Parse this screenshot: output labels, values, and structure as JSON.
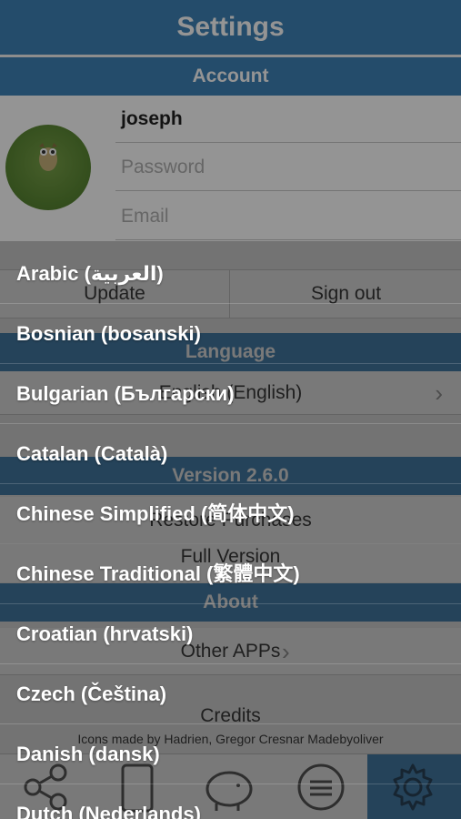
{
  "header": {
    "title": "Settings"
  },
  "account": {
    "section_label": "Account",
    "username": "joseph",
    "password_placeholder": "Password",
    "email_placeholder": "Email",
    "update_label": "Update",
    "signout_label": "Sign out"
  },
  "language": {
    "section_label": "Language",
    "current": "English (English)"
  },
  "version": {
    "section_label": "Version 2.6.0",
    "restore_label": "Restore Purchases",
    "full_label": "Full Version"
  },
  "about": {
    "section_label": "About",
    "other_apps_label": "Other APPs",
    "credits_title": "Credits",
    "credits_text": "Icons made by Hadrien, Gregor Cresnar Madebyoliver"
  },
  "tabs": [
    {
      "icon": "share-icon"
    },
    {
      "icon": "phone-icon"
    },
    {
      "icon": "piggy-bank-icon"
    },
    {
      "icon": "chat-icon"
    },
    {
      "icon": "gear-icon"
    }
  ],
  "colors": {
    "accent": "#3f84b8"
  },
  "picker": {
    "items": [
      "Arabic (العربية)",
      "Bosnian (bosanski)",
      "Bulgarian (Български)",
      "Catalan (Català)",
      "Chinese Simplified (简体中文)",
      "Chinese Traditional (繁體中文)",
      "Croatian (hrvatski)",
      "Czech (Čeština)",
      "Danish (dansk)",
      "Dutch (Nederlands)"
    ]
  }
}
